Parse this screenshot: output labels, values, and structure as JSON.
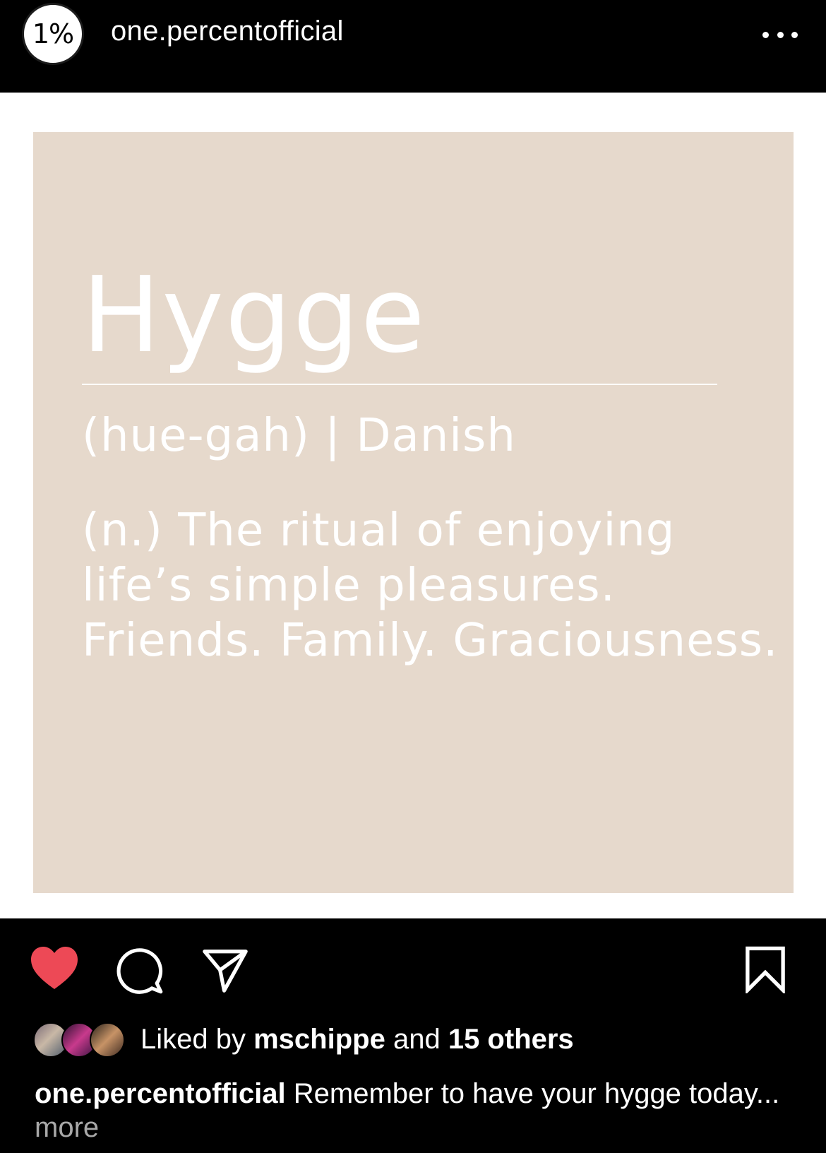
{
  "header": {
    "avatar_text": "1%",
    "username": "one.percentofficial",
    "more_icon": "ellipsis-icon"
  },
  "post": {
    "title": "Hygge",
    "pronunciation": "(hue-gah) | Danish",
    "definition_lines": [
      "(n.) The ritual of enjoying",
      "life’s simple pleasures.",
      "Friends. Family. Graciousness."
    ],
    "card_color": "#e6d9cc"
  },
  "actions": {
    "like_icon": "heart-filled-icon",
    "comment_icon": "comment-icon",
    "share_icon": "paper-plane-icon",
    "save_icon": "bookmark-icon",
    "liked": true,
    "like_color": "#ed4956"
  },
  "likes": {
    "prefix": "Liked by",
    "user": "mschippe",
    "middle": "and",
    "others": "15 others"
  },
  "caption": {
    "username": "one.percentofficial",
    "text": "Remember to have your hygge today...",
    "more": "more"
  }
}
